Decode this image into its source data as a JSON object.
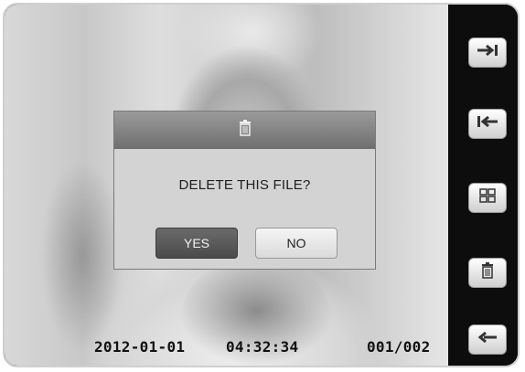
{
  "dialog": {
    "message": "DELETE THIS FILE?",
    "yes_label": "YES",
    "no_label": "NO",
    "header_icon": "trash-icon"
  },
  "status": {
    "date": "2012-01-01",
    "time": "04:32:34",
    "file_index": "001/002"
  },
  "rail_buttons": [
    {
      "icon": "next-icon"
    },
    {
      "icon": "previous-icon"
    },
    {
      "icon": "thumbnail-grid-icon"
    },
    {
      "icon": "trash-icon"
    },
    {
      "icon": "back-icon"
    }
  ],
  "colors": {
    "rail_background": "#0d0d0d",
    "dialog_background": "#d3d3d3",
    "dialog_header": "#7a7a7a",
    "yes_button": "#555555",
    "no_button": "#e6e6e6"
  }
}
